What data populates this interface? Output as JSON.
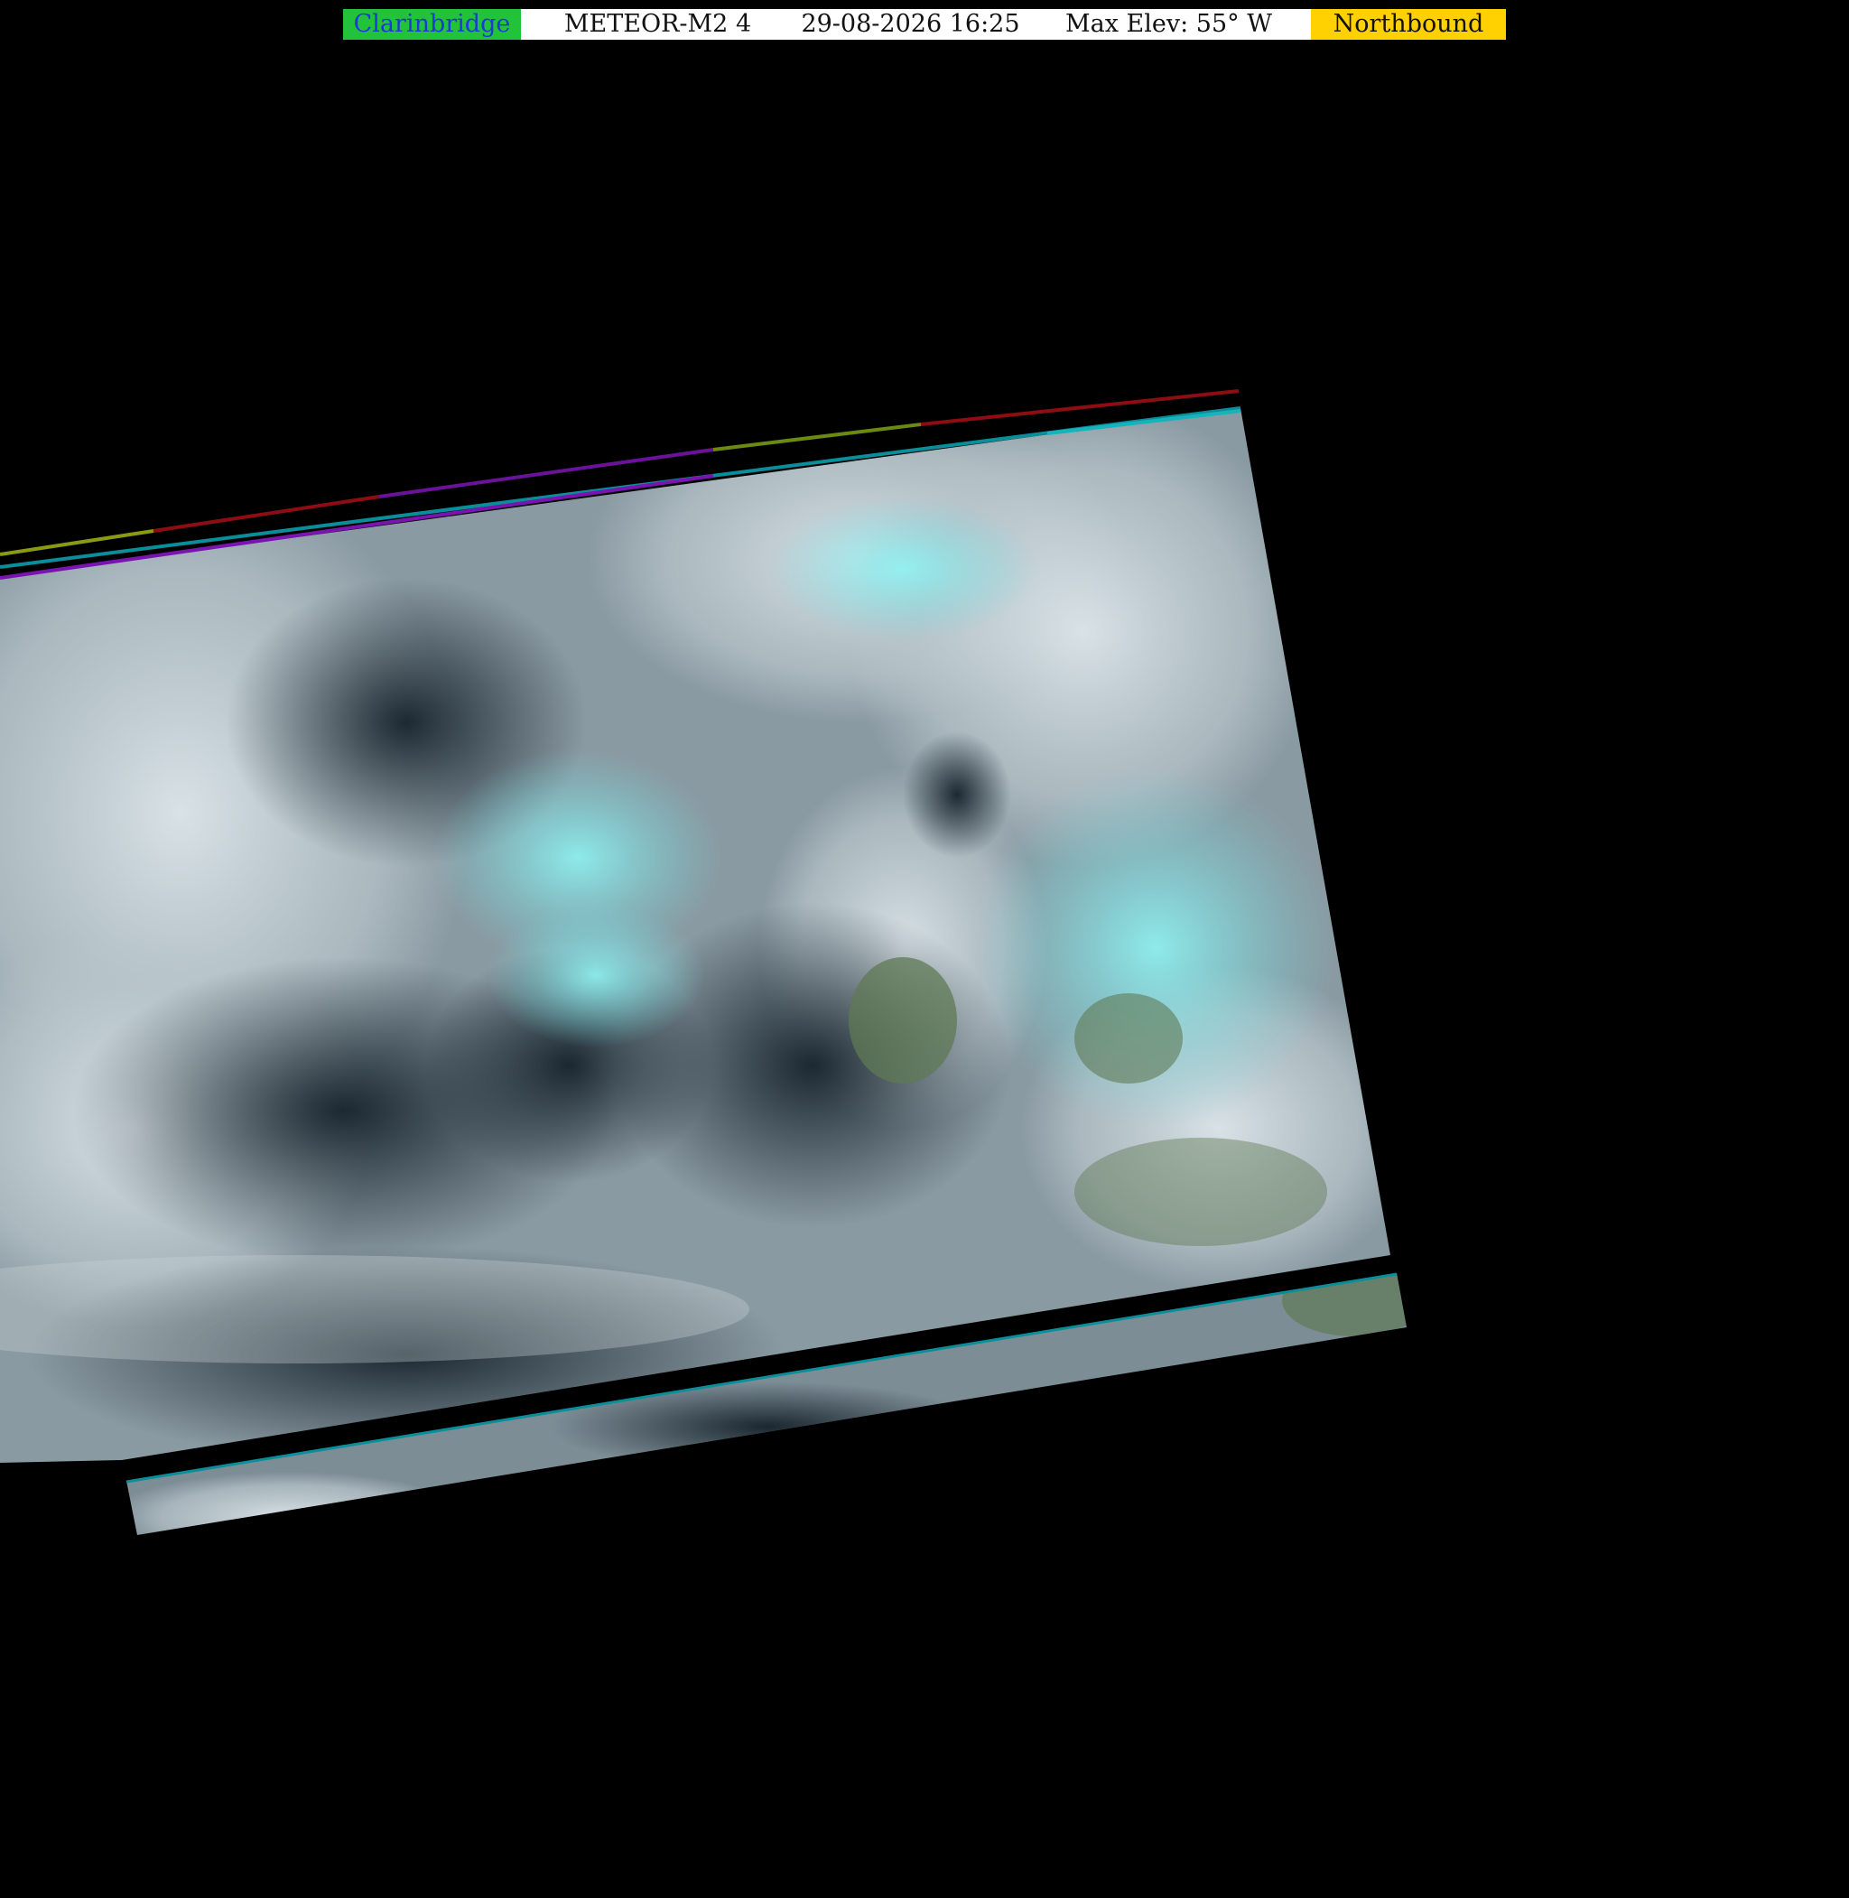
{
  "header": {
    "station": "Clarinbridge",
    "satellite": "METEOR-M2 4",
    "datetime": "29-08-2026 16:25",
    "max_elevation": "Max Elev: 55° W",
    "direction": "Northbound"
  },
  "colors": {
    "background": "#000000",
    "station_bg": "#22c33a",
    "station_text": "#1a3bd6",
    "direction_bg": "#ffd100",
    "header_bg": "#ffffff",
    "cloud": "#c9d3d8",
    "cloud_cyan": "#7ee8ea",
    "ocean": "#1c2a33",
    "land": "#5f7a55"
  }
}
